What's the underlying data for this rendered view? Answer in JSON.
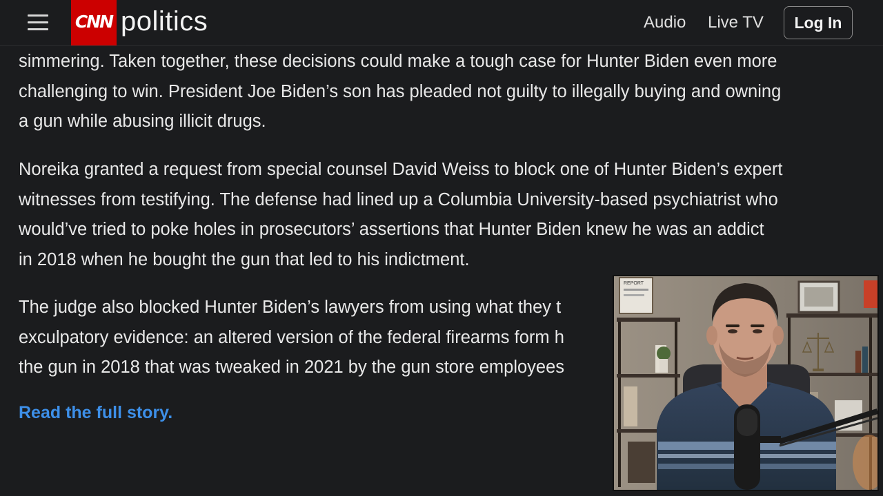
{
  "header": {
    "logo": "CNN",
    "section": "politics",
    "nav": {
      "audio": "Audio",
      "live_tv": "Live TV",
      "login": "Log In"
    }
  },
  "article": {
    "paragraphs": [
      {
        "lines": [
          "simmering. Taken together, these decisions could make a tough case for Hunter Biden even more",
          "challenging to win. President Joe Biden’s son has pleaded not guilty to illegally buying and owning",
          "a gun while abusing illicit drugs."
        ]
      },
      {
        "lines": [
          "Noreika granted a request from special counsel David Weiss to block one of Hunter Biden’s expert",
          "witnesses from testifying. The defense had lined up a Columbia University-based psychiatrist who",
          "would’ve tried to poke holes in prosecutors’ assertions that Hunter Biden knew he was an addict",
          "in 2018 when he bought the gun that led to his indictment."
        ]
      },
      {
        "lines": [
          "The judge also blocked Hunter Biden’s lawyers from using what they t",
          "exculpatory evidence: an altered version of the federal firearms form h",
          "the gun in 2018 that was tweaked in 2021 by the gun store employees"
        ]
      }
    ],
    "read_more": "Read the full story."
  },
  "webcam": {
    "poster_label_1": "REPORT",
    "colors": {
      "wall": "#8a8175",
      "shirt": "#2c3a4f",
      "shirt_stripe": "#8aa4c4",
      "skin": "#c99a82",
      "hair": "#2a2420",
      "mic": "#1a1a1a",
      "shelf": "#3a302a"
    }
  },
  "colors": {
    "background": "#1b1c1e",
    "text": "#e8e8e8",
    "brand_red": "#cc0000",
    "link_blue": "#3d8fe8"
  }
}
